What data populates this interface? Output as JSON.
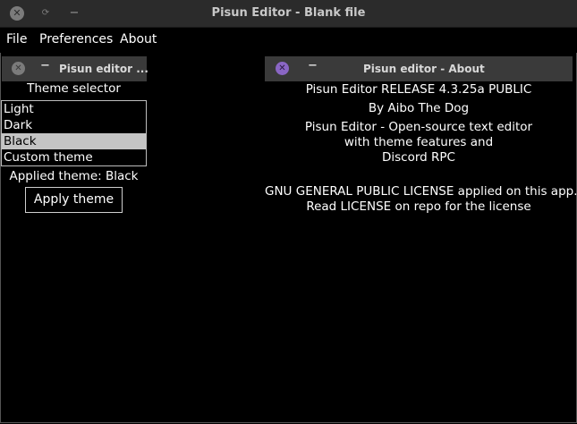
{
  "window": {
    "title": "Pisun Editor - Blank file",
    "close_glyph": "✕",
    "min_glyph": "−"
  },
  "menubar": {
    "items": [
      "File",
      "Preferences",
      "About"
    ]
  },
  "theme_panel": {
    "title": "Pisun editor ...",
    "heading": "Theme selector",
    "options": [
      "Light",
      "Dark",
      "Black",
      "Custom theme"
    ],
    "selected_index": 2,
    "applied_text": "Applied theme: Black",
    "apply_button_label": "Apply theme"
  },
  "about_panel": {
    "title": "Pisun editor - About",
    "lines": [
      "Pisun Editor RELEASE 4.3.25a PUBLIC",
      "By Aibo The Dog",
      "Pisun Editor - Open-source text editor",
      "with theme features and",
      "Discord RPC",
      "GNU GENERAL PUBLIC LICENSE applied on this app.",
      "Read LICENSE on repo for the license"
    ]
  },
  "colors": {
    "background": "#000000",
    "titlebar": "#2b2b2b",
    "panel_header": "#3a3a3a",
    "selection": "#c4c4c4",
    "about_close_accent": "#8a66c4"
  },
  "icons": {
    "window_close": "close-icon",
    "window_restore": "restore-icon",
    "window_minimize": "minimize-icon"
  }
}
